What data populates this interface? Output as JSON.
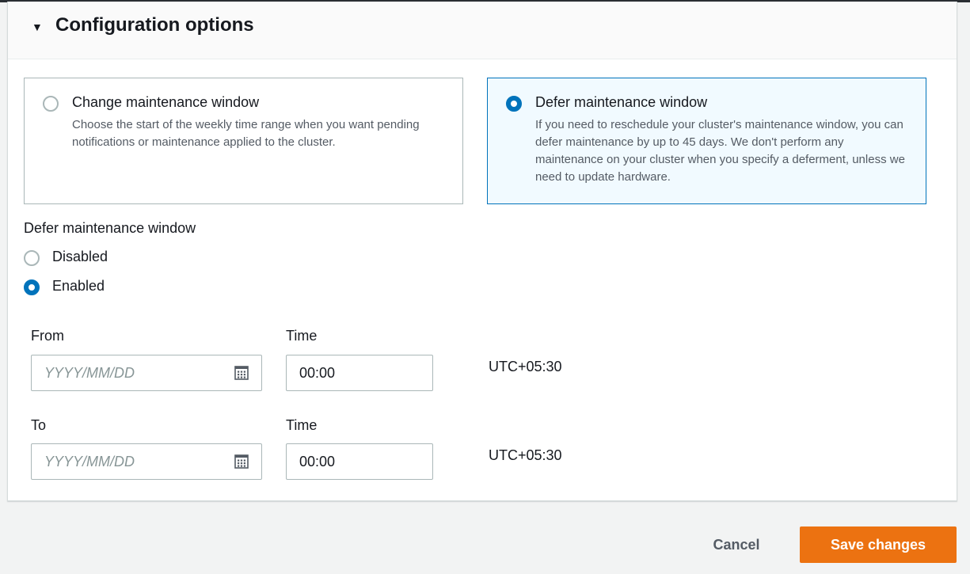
{
  "section": {
    "title": "Configuration options",
    "caret": "▼"
  },
  "tiles": [
    {
      "label": "Change maintenance window",
      "description": "Choose the start of the weekly time range when you want pending notifications or maintenance applied to the cluster.",
      "selected": false
    },
    {
      "label": "Defer maintenance window",
      "description": "If you need to reschedule your cluster's maintenance window, you can defer maintenance by up to 45 days. We don't perform any maintenance on your cluster when you specify a deferment, unless we need to update hardware.",
      "selected": true
    }
  ],
  "defer": {
    "label": "Defer maintenance window",
    "options": [
      {
        "label": "Disabled",
        "selected": false
      },
      {
        "label": "Enabled",
        "selected": true
      }
    ]
  },
  "from": {
    "label": "From",
    "date_placeholder": "YYYY/MM/DD",
    "date_value": "",
    "time_label": "Time",
    "time_value": "00:00",
    "timezone": "UTC+05:30"
  },
  "to": {
    "label": "To",
    "date_placeholder": "YYYY/MM/DD",
    "date_value": "",
    "time_label": "Time",
    "time_value": "00:00",
    "timezone": "UTC+05:30"
  },
  "actions": {
    "cancel": "Cancel",
    "save": "Save changes"
  },
  "colors": {
    "primary_button": "#ec7211",
    "selected_radio": "#0073bb",
    "selected_tile_bg": "#f1faff"
  },
  "icons": {
    "caret": "caret-down-icon",
    "calendar": "calendar-icon"
  }
}
